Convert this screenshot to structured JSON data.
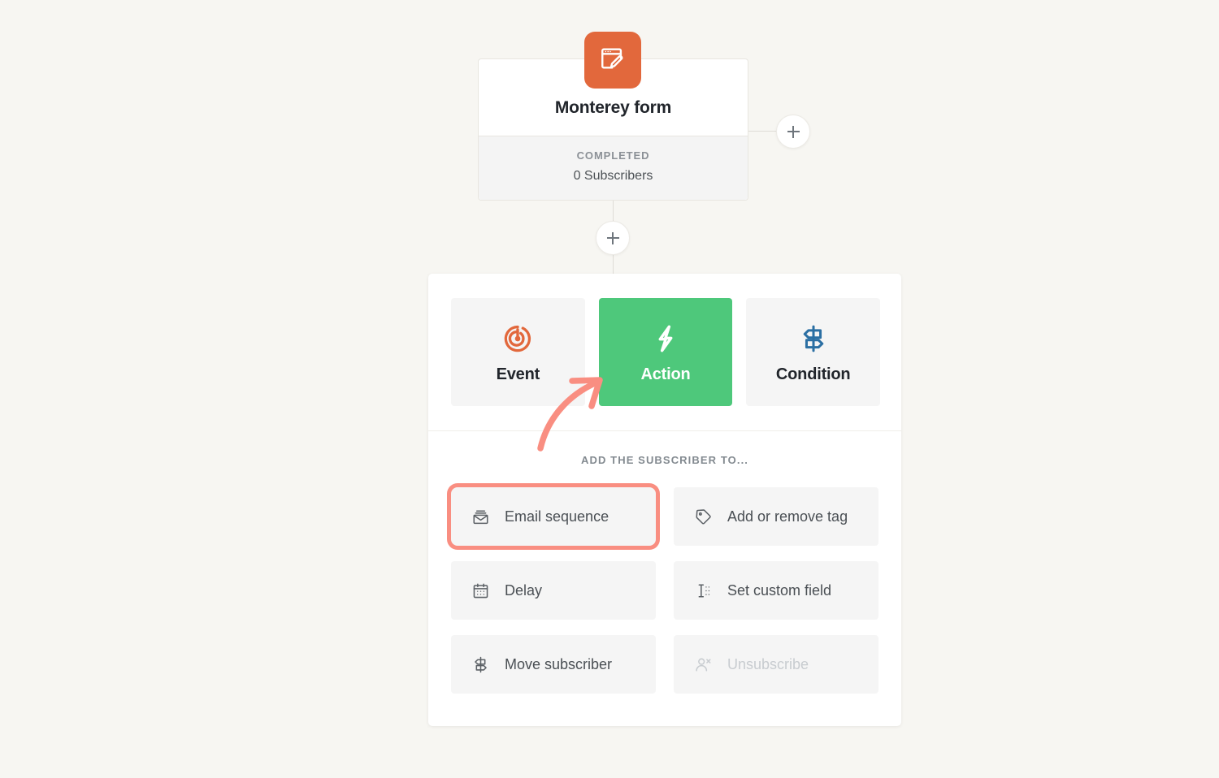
{
  "colors": {
    "page_background": "#f7f6f2",
    "brand_orange": "#e2683c",
    "action_green": "#4ec87b",
    "condition_blue": "#2b6fa3",
    "annotation_coral": "#f98e81",
    "panel_white": "#ffffff",
    "tile_grey": "#f5f5f5"
  },
  "flow": {
    "trigger_node": {
      "icon": "form-edit-icon",
      "title": "Monterey form",
      "status": "COMPLETED",
      "subscribers": "0 Subscribers"
    },
    "add_buttons": [
      {
        "name": "add-step-right",
        "label": "+"
      },
      {
        "name": "add-step-below",
        "label": "+"
      }
    ]
  },
  "picker": {
    "tabs": [
      {
        "label": "Event",
        "icon": "radar-pulse-icon",
        "selected": false
      },
      {
        "label": "Action",
        "icon": "lightning-bolt-icon",
        "selected": true
      },
      {
        "label": "Condition",
        "icon": "signpost-icon",
        "selected": false
      }
    ],
    "options_heading": "ADD THE SUBSCRIBER TO...",
    "options": [
      {
        "label": "Email sequence",
        "icon": "email-stack-icon",
        "highlighted": true,
        "disabled": false
      },
      {
        "label": "Add or remove tag",
        "icon": "tag-icon",
        "highlighted": false,
        "disabled": false
      },
      {
        "label": "Delay",
        "icon": "calendar-icon",
        "highlighted": false,
        "disabled": false
      },
      {
        "label": "Set custom field",
        "icon": "text-cursor-icon",
        "highlighted": false,
        "disabled": false
      },
      {
        "label": "Move subscriber",
        "icon": "signpost-icon",
        "highlighted": false,
        "disabled": false
      },
      {
        "label": "Unsubscribe",
        "icon": "user-remove-icon",
        "highlighted": false,
        "disabled": true
      }
    ]
  },
  "annotation": {
    "arrow": {
      "name": "pointer-arrow",
      "points_to": "Action",
      "color": "#f98e81"
    }
  }
}
